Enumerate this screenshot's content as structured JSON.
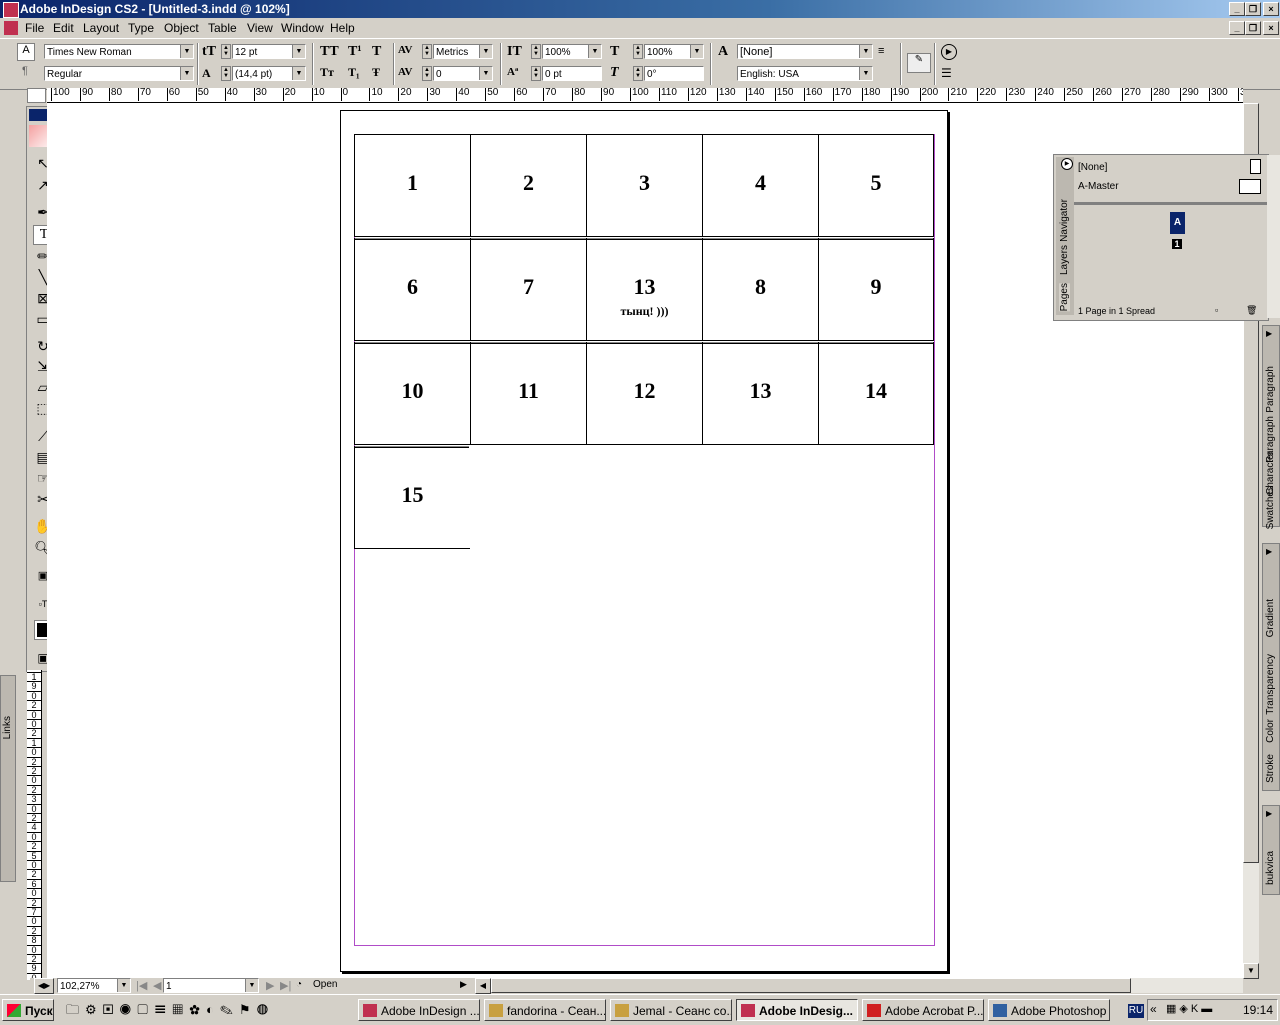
{
  "window": {
    "title": "Adobe InDesign CS2 - [Untitled-3.indd @ 102%]"
  },
  "menu": [
    "File",
    "Edit",
    "Layout",
    "Type",
    "Object",
    "Table",
    "View",
    "Window",
    "Help"
  ],
  "control_panel": {
    "font_family": "Times New Roman",
    "font_style": "Regular",
    "font_size": "12 pt",
    "leading": "(14,4 pt)",
    "kerning": "Metrics",
    "tracking": "0",
    "vertical_scale": "100%",
    "horizontal_scale": "100%",
    "baseline_shift": "0 pt",
    "skew": "0°",
    "char_style": "[None]",
    "language": "English: USA"
  },
  "ruler": {
    "h": [
      "100",
      "90",
      "80",
      "70",
      "60",
      "50",
      "40",
      "30",
      "20",
      "10",
      "0",
      "10",
      "20",
      "30",
      "40",
      "50",
      "60",
      "70",
      "80",
      "90",
      "100",
      "110",
      "120",
      "130",
      "140",
      "150",
      "160",
      "170",
      "180",
      "190",
      "200",
      "210",
      "220",
      "230",
      "240",
      "250",
      "260",
      "270",
      "280",
      "290",
      "300",
      "3"
    ],
    "v": [
      "1",
      "9",
      "0",
      "2",
      "0",
      "0",
      "2",
      "1",
      "0",
      "2",
      "2",
      "0",
      "2",
      "3",
      "0",
      "2",
      "4",
      "0",
      "2",
      "5",
      "0",
      "2",
      "6",
      "0",
      "2",
      "7",
      "0",
      "2",
      "8",
      "0",
      "2",
      "9",
      "0"
    ]
  },
  "table": {
    "rows": [
      [
        {
          "n": "1"
        },
        {
          "n": "2"
        },
        {
          "n": "3"
        },
        {
          "n": "4"
        },
        {
          "n": "5"
        }
      ],
      [
        {
          "n": "6"
        },
        {
          "n": "7"
        },
        {
          "n": "13",
          "sub": "тынц! )))"
        },
        {
          "n": "8"
        },
        {
          "n": "9"
        }
      ],
      [
        {
          "n": "10"
        },
        {
          "n": "11"
        },
        {
          "n": "12"
        },
        {
          "n": "13"
        },
        {
          "n": "14"
        }
      ],
      [
        {
          "n": "15"
        }
      ]
    ]
  },
  "pages_panel": {
    "none_label": "[None]",
    "master_label": "A-Master",
    "master_badge": "A",
    "page_number": "1",
    "status": "1 Page in 1 Spread",
    "tabs": [
      "Navigator",
      "Layers",
      "Pages"
    ]
  },
  "side_tabs": {
    "group1": [
      "Paragraph",
      "Paragraph",
      "Character",
      "Swatches"
    ],
    "group2": [
      "Gradient",
      "Transparency",
      "Color",
      "Stroke"
    ],
    "group3": [
      "bukvica"
    ],
    "links": "Links"
  },
  "status": {
    "zoom": "102,27%",
    "page": "1",
    "open": "Open"
  },
  "taskbar": {
    "start": "Пуск",
    "tasks": [
      "Adobe InDesign ...",
      "fandorina - Сеан...",
      "Jemal - Сеанс со...",
      "Adobe InDesig...",
      "Adobe Acrobat P...",
      "Adobe Photoshop"
    ],
    "active_index": 3,
    "lang": "RU",
    "clock": "19:14"
  }
}
